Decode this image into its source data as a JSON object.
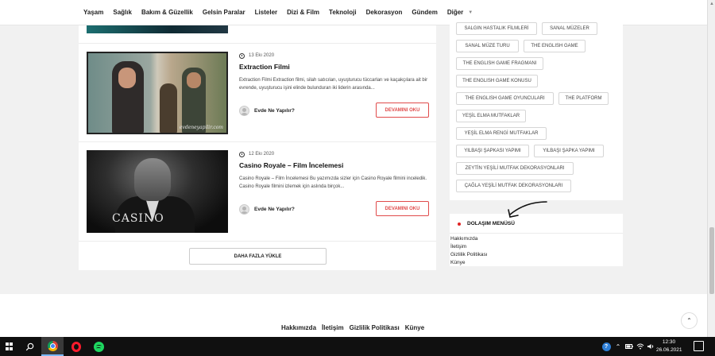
{
  "nav": {
    "items": [
      "Yaşam",
      "Sağlık",
      "Bakım & Güzellik",
      "Gelsin Paralar",
      "Listeler",
      "Dizi & Film",
      "Teknoloji",
      "Dekorasyon",
      "Gündem",
      "Diğer"
    ]
  },
  "posts": [
    {
      "date": "13 Ekı 2020",
      "title": "Extraction Filmi",
      "excerpt": "Extraction Filmi Extraction filmi, silah satıcıları, uyuşturucu tüccarları ve kaçakçılara ait bir evrende, uyuşturucu işini elinde bulunduran iki liderin arasında...",
      "author": "Evde Ne Yapılır?",
      "read_more": "DEVAMINI OKU",
      "thumb_watermark": "evdeneyapilir.com"
    },
    {
      "date": "12 Ekı 2020",
      "title": "Casino Royale – Film İncelemesi",
      "excerpt": "Casino Royale – Film İncelemesi Bu yazımızda sizler için Casino Royale filmini inceledik. Casino Royale filmini izlemek için aslında birçok...",
      "author": "Evde Ne Yapılır?",
      "read_more": "DEVAMINI OKU",
      "thumb_logo": "CASINO"
    }
  ],
  "load_more": "DAHA FAZLA YÜKLE",
  "tags": [
    "SALGIN HASTALIK FİLMLERİ",
    "SANAL MÜZELER",
    "SANAL MÜZE TURU",
    "THE ENGLISH GAME",
    "THE ENGLISH GAME FRAGMANI",
    "THE ENGLISH GAME KONUSU",
    "THE ENGLISH GAME OYUNCULARI",
    "THE PLATFORM",
    "YEŞİL ELMA MUTFAKLAR",
    "YEŞİL ELMA RENGİ MUTFAKLAR",
    "YILBAŞI ŞAPKASI YAPIMI",
    "YILBAŞI ŞAPKA YAPIMI",
    "ZEYTİN YEŞİLİ MUTFAK DEKORASYONLARI",
    "ÇAĞLA YEŞİLİ MUTFAK DEKORASYONLARI"
  ],
  "nav_menu": {
    "heading": "DOLAŞIM MENÜSÜ",
    "links": [
      "Hakkımızda",
      "İletişim",
      "Gizlilik Politikası",
      "Künye"
    ]
  },
  "footer": {
    "links": [
      "Hakkımızda",
      "İletişim",
      "Gizlilik Politikası",
      "Künye"
    ]
  },
  "taskbar": {
    "time": "12:30",
    "date": "26.06.2021",
    "help_glyph": "?"
  },
  "colors": {
    "accent_red": "#e04b4b",
    "dot_red": "#e02424"
  }
}
